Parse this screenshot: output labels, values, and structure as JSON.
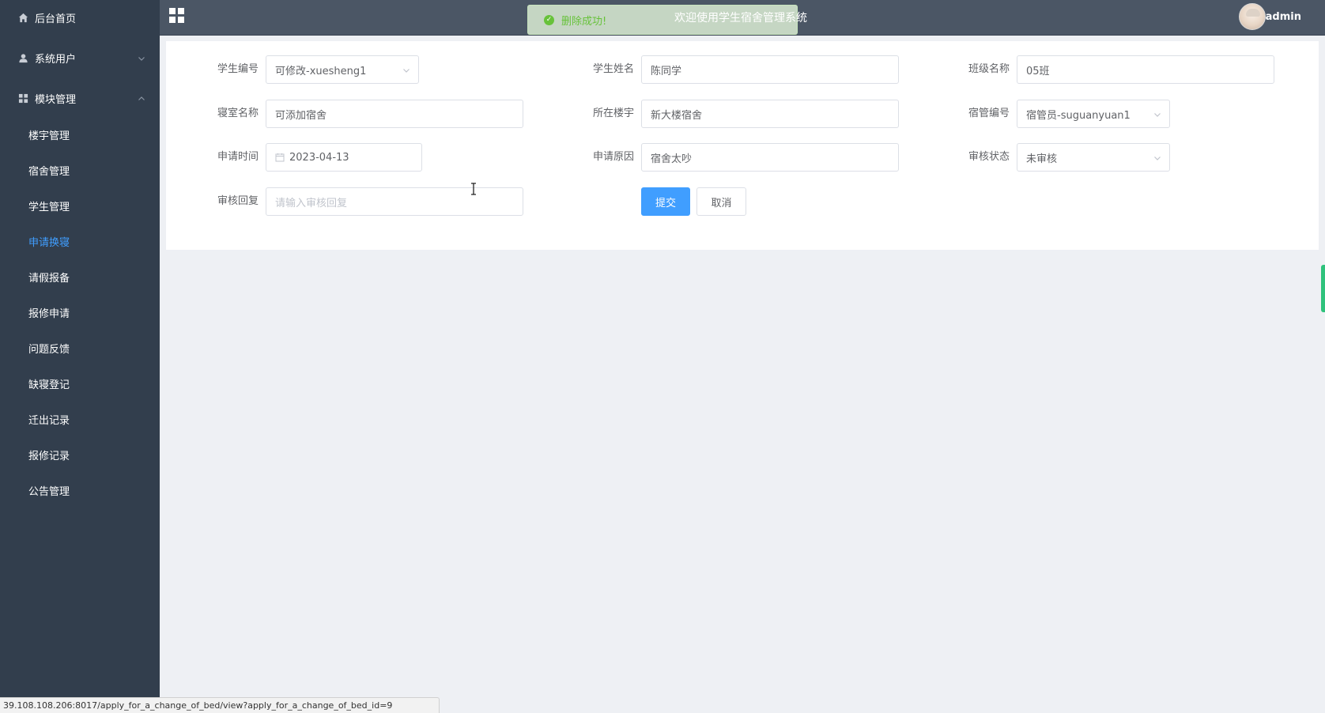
{
  "sidebar": {
    "home": {
      "label": "后台首页",
      "icon": "home-icon"
    },
    "system_users": {
      "label": "系统用户",
      "icon": "user-icon"
    },
    "modules": {
      "label": "模块管理",
      "icon": "grid-icon"
    },
    "sub_items": [
      {
        "label": "楼宇管理"
      },
      {
        "label": "宿舍管理"
      },
      {
        "label": "学生管理"
      },
      {
        "label": "申请换寝",
        "active": true
      },
      {
        "label": "请假报备"
      },
      {
        "label": "报修申请"
      },
      {
        "label": "问题反馈"
      },
      {
        "label": "缺寝登记"
      },
      {
        "label": "迁出记录"
      },
      {
        "label": "报修记录"
      },
      {
        "label": "公告管理"
      }
    ]
  },
  "header": {
    "title": "欢迎使用学生宿舍管理系统",
    "username": "admin",
    "toast": "删除成功!"
  },
  "form": {
    "student_no": {
      "label": "学生编号",
      "value": "可修改-xuesheng1"
    },
    "student_name": {
      "label": "学生姓名",
      "value": "陈同学"
    },
    "class_name": {
      "label": "班级名称",
      "value": "05班"
    },
    "dorm_name": {
      "label": "寝室名称",
      "value": "可添加宿舍"
    },
    "building": {
      "label": "所在楼宇",
      "value": "新大楼宿舍"
    },
    "manager_no": {
      "label": "宿管编号",
      "value": "宿管员-suguanyuan1"
    },
    "apply_time": {
      "label": "申请时间",
      "value": "2023-04-13"
    },
    "apply_reason": {
      "label": "申请原因",
      "value": "宿舍太吵"
    },
    "review_status": {
      "label": "审核状态",
      "value": "未审核"
    },
    "review_reply": {
      "label": "审核回复",
      "placeholder": "请输入审核回复"
    },
    "submit_label": "提交",
    "cancel_label": "取消"
  },
  "status_bar": {
    "url": "39.108.108.206:8017/apply_for_a_change_of_bed/view?apply_for_a_change_of_bed_id=9"
  },
  "colors": {
    "sidebar_bg": "#323e4d",
    "header_bg": "#4b5665",
    "accent": "#409eff",
    "success": "#67c23a"
  }
}
